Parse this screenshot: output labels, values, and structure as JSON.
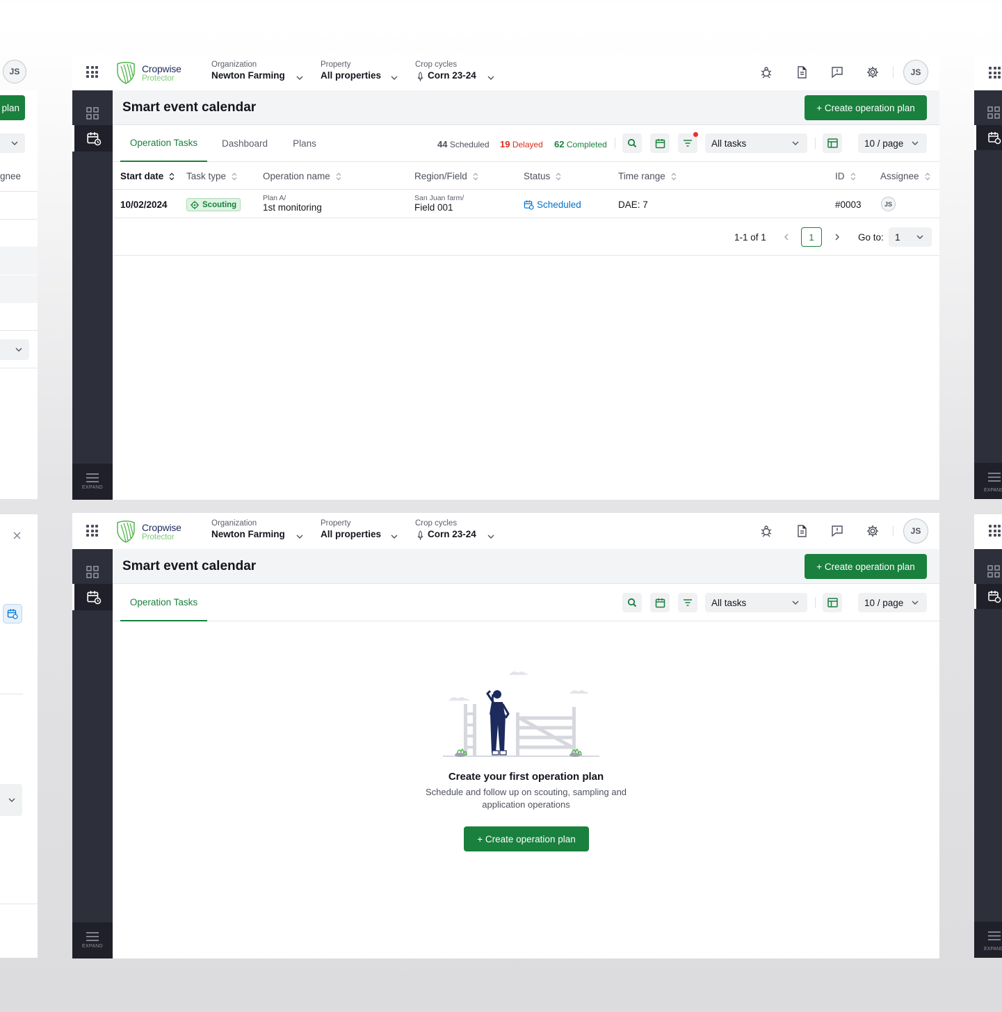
{
  "header": {
    "brand_line1": "Cropwise",
    "brand_line2": "Protector",
    "org_label": "Organization",
    "org_value": "Newton Farming",
    "property_label": "Property",
    "property_value": "All properties",
    "crop_label": "Crop cycles",
    "crop_value": "Corn 23-24",
    "avatar": "JS"
  },
  "sidebar": {
    "expand": "EXPAND"
  },
  "page": {
    "title": "Smart event calendar",
    "create_button": "+ Create operation plan"
  },
  "tabs": [
    "Operation Tasks",
    "Dashboard",
    "Plans"
  ],
  "counts": {
    "scheduled_num": "44",
    "scheduled_label": "Scheduled",
    "delayed_num": "19",
    "delayed_label": "Delayed",
    "completed_num": "62",
    "completed_label": "Completed"
  },
  "filters": {
    "task_filter": "All tasks",
    "page_size": "10 / page"
  },
  "table": {
    "columns": [
      "Start date",
      "Task type",
      "Operation name",
      "Region/Field",
      "Status",
      "Time range",
      "ID",
      "Assignee"
    ],
    "rows": [
      {
        "start_date": "10/02/2024",
        "task_type": "Scouting",
        "plan": "Plan A/",
        "operation": "1st monitoring",
        "farm": "San Juan farm/",
        "field": "Field 001",
        "status": "Scheduled",
        "time_range": "DAE: 7",
        "id": "#0003",
        "assignee": "JS"
      }
    ]
  },
  "pagination": {
    "range": "1-1 of 1",
    "current": "1",
    "goto_label": "Go to:",
    "goto_value": "1"
  },
  "empty": {
    "title": "Create your first operation plan",
    "line1": "Schedule and follow up on scouting, sampling and",
    "line2": "application operations",
    "button": "+  Create operation plan"
  },
  "left_partial": {
    "avatar": "JS",
    "button_fragment": "plan",
    "column_fragment": "gnee"
  },
  "colors": {
    "green": "#19803d",
    "sidebar": "#2d2f3a",
    "delayed": "#d92d20",
    "scheduled": "#0071cd"
  }
}
